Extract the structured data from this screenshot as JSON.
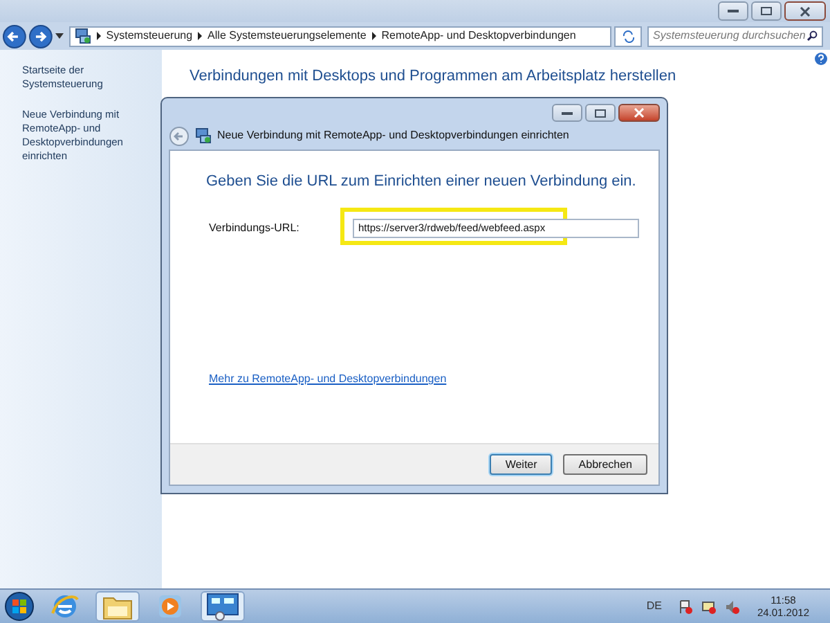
{
  "address_bar": {
    "crumbs": [
      "Systemsteuerung",
      "Alle Systemsteuerungselemente",
      "RemoteApp- und Desktopverbindungen"
    ]
  },
  "search": {
    "placeholder": "Systemsteuerung durchsuchen"
  },
  "sidebar": {
    "items": [
      "Startseite der Systemsteuerung",
      "Neue Verbindung mit RemoteApp- und Desktopverbindungen einrichten"
    ]
  },
  "main": {
    "heading": "Verbindungen mit Desktops und Programmen am Arbeitsplatz herstellen"
  },
  "dialog": {
    "title": "Neue Verbindung mit RemoteApp- und Desktopverbindungen einrichten",
    "heading": "Geben Sie die URL zum Einrichten einer neuen Verbindung ein.",
    "field_label": "Verbindungs-URL:",
    "field_value": "https://server3/rdweb/feed/webfeed.aspx",
    "highlighted": true,
    "link": "Mehr zu RemoteApp- und Desktopverbindungen",
    "buttons": [
      {
        "label": "Weiter",
        "default": true
      },
      {
        "label": "Abbrechen",
        "default": false
      }
    ]
  },
  "taskbar": {
    "items": [
      {
        "kind": "browser",
        "selected": false
      },
      {
        "kind": "folder",
        "selected": true
      },
      {
        "kind": "media",
        "selected": false
      },
      {
        "kind": "panel",
        "selected": true
      }
    ],
    "language": "DE",
    "time": "11:58",
    "date": "24.01.2012"
  }
}
